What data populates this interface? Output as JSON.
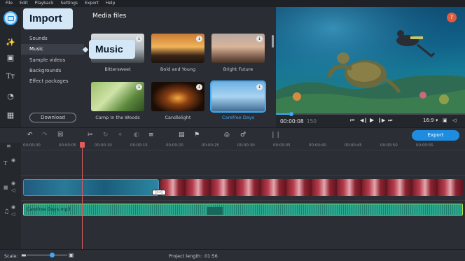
{
  "menu": [
    "File",
    "Edit",
    "Playback",
    "Settings",
    "Export",
    "Help"
  ],
  "sidebar": {
    "categories": [
      "Sounds",
      "Music",
      "Sample videos",
      "Backgrounds",
      "Effect packages"
    ],
    "download_label": "Download"
  },
  "media": {
    "title": "Media files",
    "items": [
      {
        "label": "Bittersweet"
      },
      {
        "label": "Bold and Young"
      },
      {
        "label": "Bright Future"
      },
      {
        "label": "Camp In the Woods"
      },
      {
        "label": "Candlelight"
      },
      {
        "label": "Carefree Days"
      }
    ]
  },
  "player": {
    "timecode": "00:00:08",
    "frame": "150",
    "aspect": "16:9 ▾",
    "help": "?"
  },
  "toolbar": {
    "export_label": "Export"
  },
  "ruler": [
    "00:00:00",
    "00:00:05",
    "00:00:10",
    "00:00:15",
    "00:00:20",
    "00:00:25",
    "00:00:30",
    "00:00:35",
    "00:00:40",
    "00:00:45",
    "00:00:50",
    "00:00:55"
  ],
  "audio_clip": {
    "name": "Carefree Days.mp3"
  },
  "status": {
    "scale_label": "Scale:",
    "project_length_label": "Project length:",
    "project_length_value": "01:56"
  },
  "callouts": {
    "import": "Import",
    "music": "Music"
  },
  "colors": {
    "accent": "#3fa9f5",
    "export": "#1e8ce0",
    "audio": "#2aa890",
    "playhead": "#e25b5b"
  }
}
